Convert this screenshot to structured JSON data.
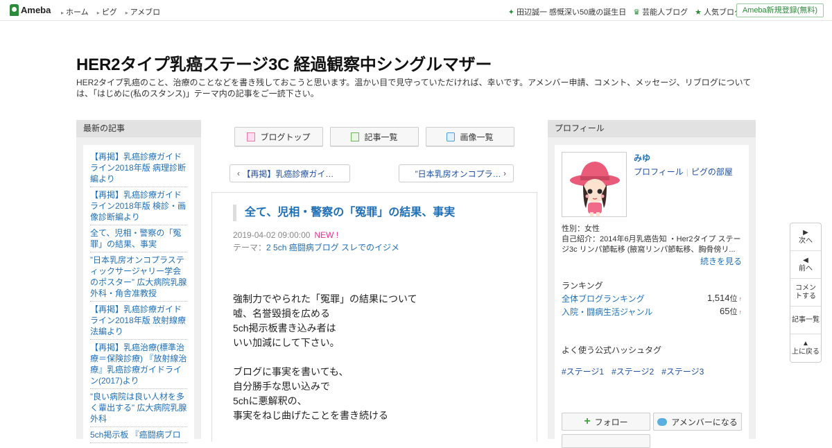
{
  "topbar": {
    "logo": "Ameba",
    "nav": [
      "ホーム",
      "ピグ",
      "アメブロ"
    ],
    "right_links": [
      {
        "icon": "diamond-icon",
        "label": "田辺誠一 感慨深い50歳の誕生日"
      },
      {
        "icon": "crown-icon",
        "label": "芸能人ブログ"
      },
      {
        "icon": "star-icon",
        "label": "人気ブログ"
      }
    ],
    "register": "Ameba新規登録(無料)"
  },
  "blog": {
    "title": "HER2タイプ乳癌ステージ3C 経過観察中シングルマザー",
    "description": "HER2タイプ乳癌のこと、治療のことなどを書き残しておこうと思います。温かい目で見守っていただければ、幸いです。アメンバー申請、コメント、メッセージ、リブログについては、「はじめに(私のスタンス)」テーマ内の記事をご一読下さい。"
  },
  "left_sidebar": {
    "heading": "最新の記事",
    "items": [
      "【再掲】乳癌診療ガイドライン2018年版 病理診断編より",
      "【再掲】乳癌診療ガイドライン2018年版 検診・画像診断編より",
      "全て、児相・警察の「冤罪」の結果、事実",
      "”日本乳房オンコプラスティックサージャリー学会のポスター” 広大病院乳腺外科・角舎准教授",
      "【再掲】乳癌診療ガイドライン2018年版 放射線療法編より",
      "【再掲】乳癌治療(標準治療＝保険診療) 『放射線治療』乳癌診療ガイドライン(2017)より",
      "”良い病院は良い人材を多く輩出する” 広大病院乳腺外科",
      "5ch掲示板 『癌闘病ブロ"
    ]
  },
  "center": {
    "buttons": [
      {
        "icon": "blog-top-icon",
        "label": "ブログトップ"
      },
      {
        "icon": "article-list-icon",
        "label": "記事一覧"
      },
      {
        "icon": "camera-icon",
        "label": "画像一覧"
      }
    ],
    "pager_prev": "【再掲】乳癌診療ガイ…",
    "pager_next": "”日本乳房オンコプラ…",
    "article": {
      "title": "全て、児相・警察の「冤罪」の結果、事実",
      "date": "2019-04-02 09:00:00",
      "new_badge": "NEW !",
      "theme_label": "テーマ：",
      "theme": "2 5ch 癌闘病ブログ スレでのイジメ",
      "body_paragraphs": [
        [
          "強制力でやられた「冤罪」の結果について",
          "嘘、名誉毀損を広める",
          "5ch掲示板書き込み者は",
          "いい加減にして下さい。"
        ],
        [
          "ブログに事実を書いても、",
          "自分勝手な思い込みで",
          "5chに悪解釈の、",
          "事実をねじ曲げたことを書き続ける"
        ]
      ]
    }
  },
  "right_sidebar": {
    "heading": "プロフィール",
    "name": "みゆ",
    "link_profile": "プロフィール",
    "link_pig": "ピグの部屋",
    "gender": "性別：女性",
    "intro": "自己紹介：2014年6月乳癌告知 ・Her2タイプ ステージ3c リンパ節転移 (腋窩リンパ節転移、胸骨傍リ...",
    "more": "続きを見る",
    "ranking_heading": "ランキング",
    "rankings": [
      {
        "label": "全体ブログランキング",
        "value": "1,514",
        "unit": "位",
        "trend": "↑"
      },
      {
        "label": "入院・闘病生活ジャンル",
        "value": "65",
        "unit": "位",
        "trend": "↑"
      }
    ],
    "tags_heading": "よく使う公式ハッシュタグ",
    "tags": [
      "#ステージ1",
      "#ステージ2",
      "#ステージ3"
    ],
    "follow": "フォロー",
    "amember": "アメンバーになる"
  },
  "floatnav": [
    {
      "icon": "triangle-right-icon",
      "label": "次へ"
    },
    {
      "icon": "triangle-left-icon",
      "label": "前へ"
    },
    {
      "icon": "",
      "label": "コメントする"
    },
    {
      "icon": "",
      "label": "記事一覧"
    },
    {
      "icon": "triangle-up-icon",
      "label": "上に戻る"
    }
  ]
}
